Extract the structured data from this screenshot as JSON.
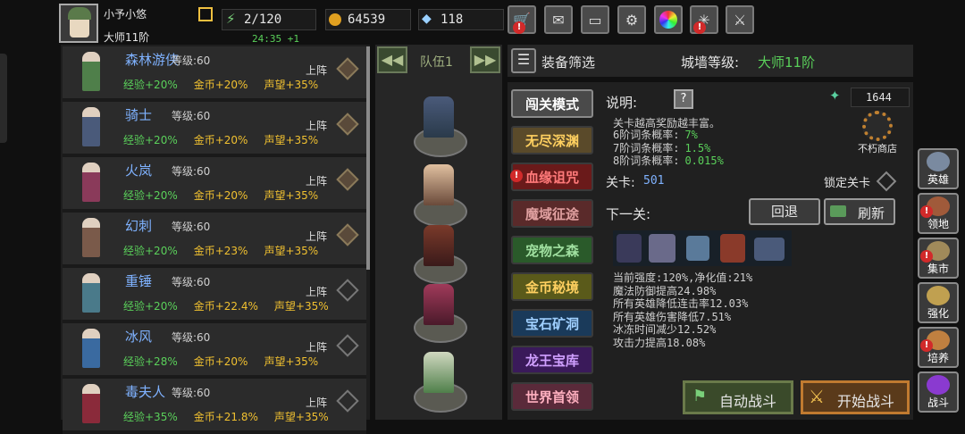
{
  "player": {
    "name": "小予小悠",
    "rank": "大师11阶"
  },
  "resources": {
    "energy": "2/120",
    "timer": "24:35 +1",
    "gold": "64539",
    "gems": "118"
  },
  "toolbar_icons": [
    "shop-cart-icon",
    "mail-icon",
    "gamepad-icon",
    "gear-icon",
    "color-wheel-icon",
    "fireworks-icon",
    "crossed-swords-icon"
  ],
  "heroes": [
    {
      "name": "森林游侠",
      "level": "等级:60",
      "exp": "经验+20%",
      "gold": "金币+20%",
      "fame": "声望+35%",
      "deploy": "上阵",
      "deployed": true,
      "color": "#4f7f4a"
    },
    {
      "name": "骑士",
      "level": "等级:60",
      "exp": "经验+20%",
      "gold": "金币+20%",
      "fame": "声望+35%",
      "deploy": "上阵",
      "deployed": true,
      "color": "#4a5a7a"
    },
    {
      "name": "火岚",
      "level": "等级:60",
      "exp": "经验+20%",
      "gold": "金币+20%",
      "fame": "声望+35%",
      "deploy": "上阵",
      "deployed": true,
      "color": "#8a3a5a"
    },
    {
      "name": "幻刺",
      "level": "等级:60",
      "exp": "经验+20%",
      "gold": "金币+23%",
      "fame": "声望+35%",
      "deploy": "上阵",
      "deployed": true,
      "color": "#7a5a4a"
    },
    {
      "name": "重锤",
      "level": "等级:60",
      "exp": "经验+20%",
      "gold": "金币+22.4%",
      "fame": "声望+35%",
      "deploy": "上阵",
      "deployed": false,
      "color": "#4a7a8a"
    },
    {
      "name": "冰风",
      "level": "等级:60",
      "exp": "经验+28%",
      "gold": "金币+20%",
      "fame": "声望+35%",
      "deploy": "上阵",
      "deployed": false,
      "color": "#3a6aa0"
    },
    {
      "name": "毒夫人",
      "level": "等级:60",
      "exp": "经验+35%",
      "gold": "金币+21.8%",
      "fame": "声望+35%",
      "deploy": "上阵",
      "deployed": false,
      "color": "#8a2a3a"
    }
  ],
  "team": {
    "label": "队伍1"
  },
  "equip_filter": "装备筛选",
  "wall": {
    "label": "城墙等级:",
    "value": "大师11阶"
  },
  "categories": [
    {
      "label": "闯关模式",
      "color": "#ffffff",
      "bg": "#4a4a4a"
    },
    {
      "label": "无尽深渊",
      "color": "#ffd060",
      "bg": "#5a4a2a"
    },
    {
      "label": "血缘诅咒",
      "color": "#ff7a7a",
      "bg": "#6a1a1a"
    },
    {
      "label": "魔域征途",
      "color": "#e0a0a0",
      "bg": "#5a2a2a"
    },
    {
      "label": "宠物之森",
      "color": "#a0e0a0",
      "bg": "#2a5a2a"
    },
    {
      "label": "金币秘境",
      "color": "#ffd060",
      "bg": "#5a5a1a"
    },
    {
      "label": "宝石矿洞",
      "color": "#a0d0ff",
      "bg": "#1a3a5a"
    },
    {
      "label": "龙王宝库",
      "color": "#d0a0ff",
      "bg": "#3a1a5a"
    },
    {
      "label": "世界首领",
      "color": "#ffb0c0",
      "bg": "#5a2a3a"
    }
  ],
  "info": {
    "title": "说明:",
    "points": "1644",
    "shop": "不朽商店",
    "desc": "关卡越高奖励越丰富。",
    "odds": [
      {
        "label": "6阶词条概率:",
        "value": "7%"
      },
      {
        "label": "7阶词条概率:",
        "value": "1.5%"
      },
      {
        "label": "8阶词条概率:",
        "value": "0.015%"
      }
    ],
    "stage_label": "关卡:",
    "stage_value": "501",
    "lock_label": "锁定关卡",
    "next_label": "下一关:",
    "back_btn": "回退",
    "refresh_btn": "刷新",
    "effects": [
      "当前强度:120%,净化值:21%",
      "魔法防御提高24.98%",
      "所有英雄降低连击率12.03%",
      "所有英雄伤害降低7.51%",
      "冰冻时间减少12.52%",
      "攻击力提高18.08%"
    ],
    "auto_btn": "自动战斗",
    "start_btn": "开始战斗"
  },
  "side_menu": [
    {
      "label": "英雄",
      "icon": "helmet-icon",
      "alert": false,
      "color": "#7a8aa0"
    },
    {
      "label": "领地",
      "icon": "castle-icon",
      "alert": true,
      "color": "#a05a3a"
    },
    {
      "label": "集市",
      "icon": "market-icon",
      "alert": true,
      "color": "#a08a5a"
    },
    {
      "label": "强化",
      "icon": "upgrade-icon",
      "alert": false,
      "color": "#c0a050"
    },
    {
      "label": "培养",
      "icon": "potion-icon",
      "alert": true,
      "color": "#c08040"
    },
    {
      "label": "战斗",
      "icon": "portal-icon",
      "alert": false,
      "color": "#8a3ad0"
    }
  ]
}
